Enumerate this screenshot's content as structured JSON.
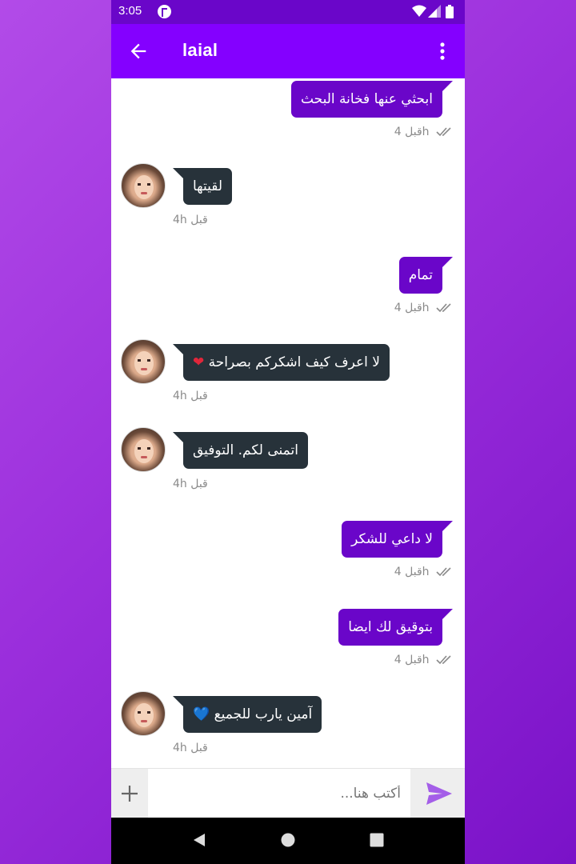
{
  "status_bar": {
    "time": "3:05",
    "icons": [
      "app-notification-icon",
      "wifi-icon",
      "signal-icon",
      "battery-icon"
    ]
  },
  "toolbar": {
    "title": "laial",
    "back_icon": "arrow-left-icon",
    "menu_icon": "more-vertical-icon",
    "color": "#8400ff"
  },
  "messages": [
    {
      "direction": "out",
      "text": "ابحثي عنها فخانة البحث",
      "time": "قبل 4h",
      "status_icon": "double-check-icon"
    },
    {
      "direction": "in",
      "text": "لقيتها",
      "time": "قبل 4h"
    },
    {
      "direction": "out",
      "text": "تمام",
      "time": "قبل 4h",
      "status_icon": "double-check-icon"
    },
    {
      "direction": "in",
      "text": "لا اعرف كيف اشكركم بصراحة",
      "emoji": "❤",
      "time": "قبل 4h"
    },
    {
      "direction": "in",
      "text": "اتمنى لكم. التوفيق",
      "time": "قبل 4h"
    },
    {
      "direction": "out",
      "text": "لا داعي للشكر",
      "time": "قبل 4h",
      "status_icon": "double-check-icon"
    },
    {
      "direction": "out",
      "text": "بتوقيق لك ايضا",
      "time": "قبل 4h",
      "status_icon": "double-check-icon"
    },
    {
      "direction": "in",
      "text": "آمين يارب للجميع",
      "emoji": "💙",
      "time": "قبل 4h"
    }
  ],
  "composer": {
    "placeholder": "أكتب هنا...",
    "attach_icon": "plus-icon",
    "send_icon": "send-icon"
  },
  "nav_bar": {
    "icons": [
      "back-triangle-icon",
      "home-circle-icon",
      "recents-square-icon"
    ]
  },
  "colors": {
    "outgoing_bubble": "#6a06c9",
    "incoming_bubble": "#27323a",
    "status_bar": "#6a06c9",
    "send": "#a45ee8"
  }
}
